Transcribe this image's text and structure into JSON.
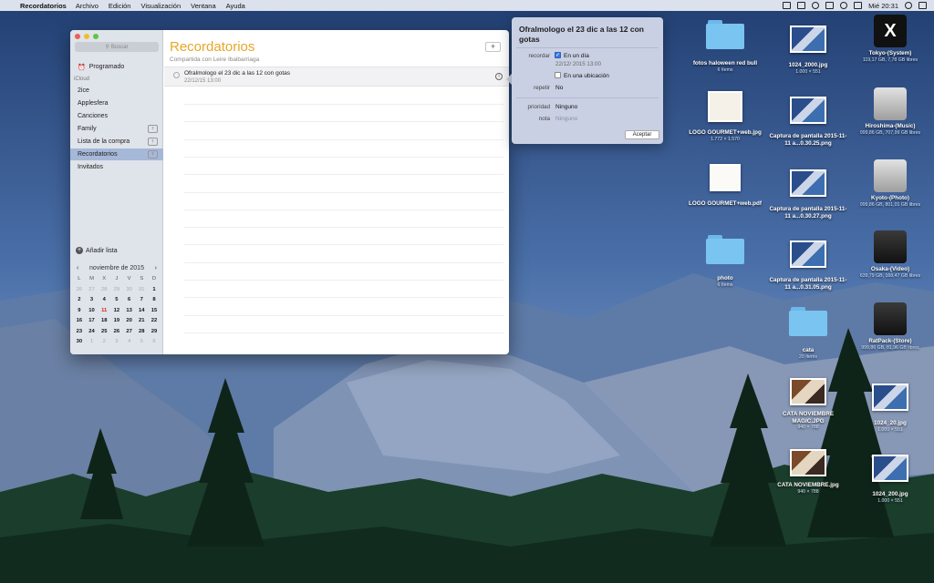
{
  "menubar": {
    "apple_glyph": "",
    "app_name": "Recordatorios",
    "menus": [
      "Archivo",
      "Edición",
      "Visualización",
      "Ventana",
      "Ayuda"
    ],
    "clock": "Mié 20:31"
  },
  "sidebar": {
    "search_placeholder": "Buscar",
    "scheduled": "Programado",
    "section": "iCloud",
    "lists": [
      "2ice",
      "Applesfera",
      "Canciones",
      "Family",
      "Lista de la compra",
      "Recordatorios",
      "Invitados"
    ],
    "selected_index": 5,
    "shared_indices": [
      3,
      4,
      5
    ],
    "add_list": "Añadir lista"
  },
  "calendar": {
    "month": "noviembre de 2015",
    "prev": "‹",
    "next": "›",
    "weekdays": [
      "L",
      "M",
      "X",
      "J",
      "V",
      "S",
      "D"
    ],
    "weeks": [
      [
        "26",
        "27",
        "28",
        "29",
        "30",
        "31",
        "1"
      ],
      [
        "2",
        "3",
        "4",
        "5",
        "6",
        "7",
        "8"
      ],
      [
        "9",
        "10",
        "11",
        "12",
        "13",
        "14",
        "15"
      ],
      [
        "16",
        "17",
        "18",
        "19",
        "20",
        "21",
        "22"
      ],
      [
        "23",
        "24",
        "25",
        "26",
        "27",
        "28",
        "29"
      ],
      [
        "30",
        "1",
        "2",
        "3",
        "4",
        "5",
        "6"
      ]
    ],
    "today": "11"
  },
  "main": {
    "title": "Recordatorios",
    "subtitle": "Compartida con Leire Ibaibarriaga",
    "add_button": "+",
    "reminder": {
      "title": "Ofralmologo el 23 dic a las 12 con gotas",
      "date": "22/12/15 13:00"
    }
  },
  "popover": {
    "title": "Ofralmologo el 23 dic a las 12 con gotas",
    "remind_label": "recordar",
    "on_day": "En un día",
    "on_day_checked": true,
    "datetime": "22/12/ 2015  13:00",
    "at_location": "En una ubicación",
    "repeat_label": "repetir",
    "repeat_value": "No",
    "priority_label": "prioridad",
    "priority_value": "Ninguno",
    "note_label": "nota",
    "note_placeholder": "Ninguno",
    "accept": "Aceptar"
  },
  "desktop_icons": [
    {
      "name": "fotos haloween red bull",
      "sub": "6 ítems",
      "kind": "folder"
    },
    {
      "name": "1024_2000.jpg",
      "sub": "1.000 × 551",
      "kind": "thumb"
    },
    {
      "name": "Tokyo-(System)",
      "sub": "119,17 GB, 7,78 GB libres",
      "kind": "xdisk"
    },
    {
      "name": "LOGO GOURMET+web.jpg",
      "sub": "1.772 × 1.570",
      "kind": "logo"
    },
    {
      "name": "Captura de pantalla 2015-11-11 a...0.30.25.png",
      "sub": "",
      "kind": "thumb"
    },
    {
      "name": "Hiroshima-(Music)",
      "sub": "999,86 GB, 707,99 GB libres",
      "kind": "disk"
    },
    {
      "name": "LOGO GOURMET+web.pdf",
      "sub": "",
      "kind": "pdf"
    },
    {
      "name": "Captura de pantalla 2015-11-11 a...0.30.27.png",
      "sub": "",
      "kind": "thumb"
    },
    {
      "name": "Kyoto-(Photo)",
      "sub": "999,86 GB, 801,01 GB libres",
      "kind": "disk"
    },
    {
      "name": "photo",
      "sub": "6 ítems",
      "kind": "folder"
    },
    {
      "name": "Captura de pantalla 2015-11-11 a...0.31.05.png",
      "sub": "",
      "kind": "thumb"
    },
    {
      "name": "Osaka-(Video)",
      "sub": "639,79 GB, 168,47 GB libres",
      "kind": "darkdisk"
    },
    {
      "name": "cata",
      "sub": "20 ítems",
      "kind": "folder"
    },
    {
      "name": "RatPack-(Store)",
      "sub": "999,86 GB, 81,96 GB libres",
      "kind": "darkdisk"
    },
    {
      "name": "CATA NOVIEMBRE MAGIC.JPG",
      "sub": "940 × 788",
      "kind": "photo"
    },
    {
      "name": "1024_20.jpg",
      "sub": "1.000 × 551",
      "kind": "thumb"
    },
    {
      "name": "CATA NOVIEMBRE.jpg",
      "sub": "940 × 788",
      "kind": "photo"
    },
    {
      "name": "1024_200.jpg",
      "sub": "1.000 × 551",
      "kind": "thumb"
    }
  ],
  "colors": {
    "accent_title": "#e8a628",
    "selection": "#a6b8d8",
    "today": "#d0261e",
    "folder": "#7ac4f1"
  }
}
